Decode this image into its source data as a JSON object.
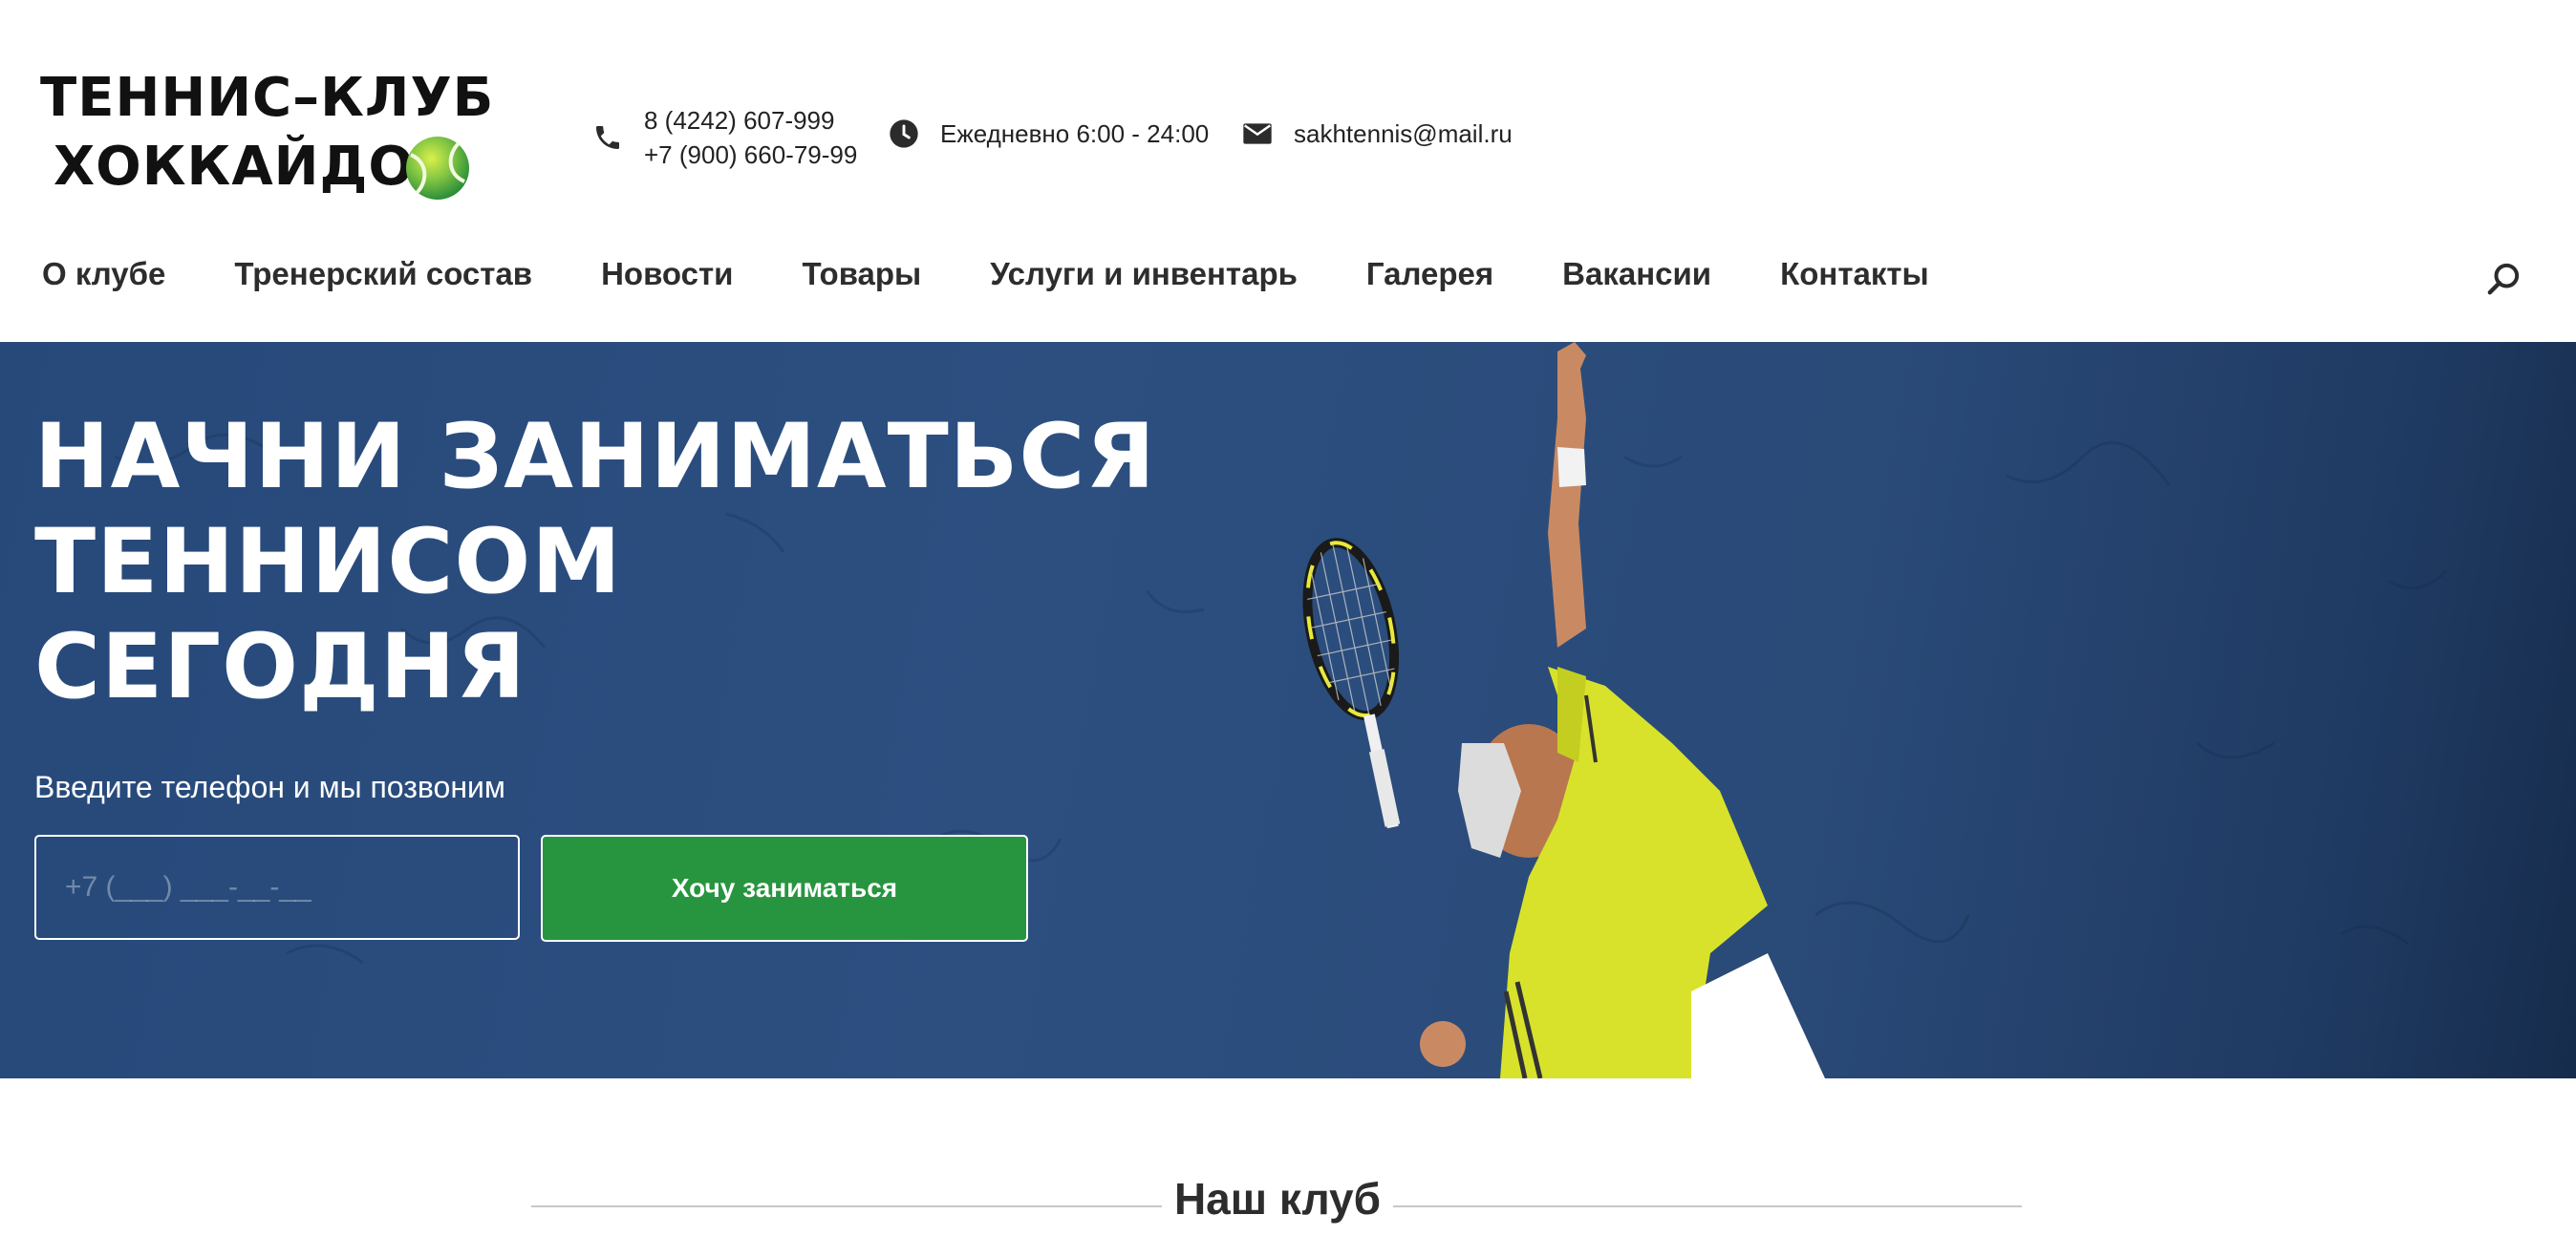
{
  "logo": {
    "line1": "ТЕННИС–КЛУБ",
    "line2": "ХОККАЙДО",
    "ball_icon": "tennis-ball-icon"
  },
  "contacts": {
    "phone_icon": "phone-icon",
    "phone1": "8 (4242) 607-999",
    "phone2": "+7 (900) 660-79-99",
    "hours_icon": "clock-icon",
    "hours": "Ежедневно 6:00 - 24:00",
    "email_icon": "envelope-icon",
    "email": "sakhtennis@mail.ru"
  },
  "nav": {
    "items": [
      {
        "label": "О клубе"
      },
      {
        "label": "Тренерский состав"
      },
      {
        "label": "Новости"
      },
      {
        "label": "Товары"
      },
      {
        "label": "Услуги и инвентарь"
      },
      {
        "label": "Галерея"
      },
      {
        "label": "Вакансии"
      },
      {
        "label": "Контакты"
      }
    ],
    "search_icon": "search-icon"
  },
  "hero": {
    "title_lines": [
      "НАЧНИ ЗАНИМАТЬСЯ",
      "ТЕННИСОМ",
      "СЕГОДНЯ"
    ],
    "subtitle": "Введите телефон и мы позвоним",
    "phone_placeholder": "+7 (___) ___-__-__",
    "button_label": "Хочу заниматься"
  },
  "section": {
    "title": "Наш клуб"
  },
  "colors": {
    "accent_green": "#27953f",
    "hero_blue": "#2c4f80",
    "text_dark": "#2d2d2d",
    "shirt_yellow": "#d8e22a"
  }
}
